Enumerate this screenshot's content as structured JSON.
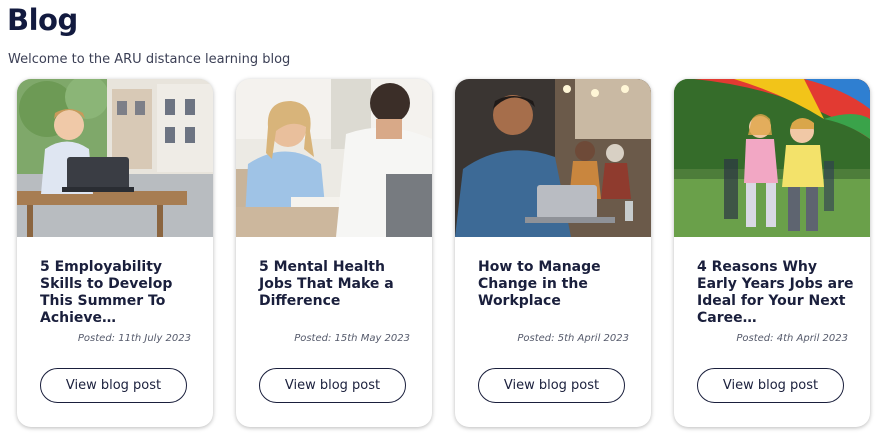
{
  "header": {
    "title": "Blog",
    "subtitle": "Welcome to the ARU distance learning blog"
  },
  "posts": [
    {
      "title": "5 Employability Skills to Develop This Summer To Achieve…",
      "date": "Posted: 11th July 2023",
      "button": "View blog post",
      "image": "student-with-laptop-outdoors"
    },
    {
      "title": "5 Mental Health Jobs That Make a Difference",
      "date": "Posted: 15th May 2023",
      "button": "View blog post",
      "image": "counselling-session"
    },
    {
      "title": "How to Manage Change in the Workplace",
      "date": "Posted: 5th April 2023",
      "button": "View blog post",
      "image": "man-smiling-at-laptop-office"
    },
    {
      "title": "4 Reasons Why Early Years Jobs are Ideal for Your Next Caree…",
      "date": "Posted: 4th April 2023",
      "button": "View blog post",
      "image": "children-parachute-game"
    }
  ]
}
